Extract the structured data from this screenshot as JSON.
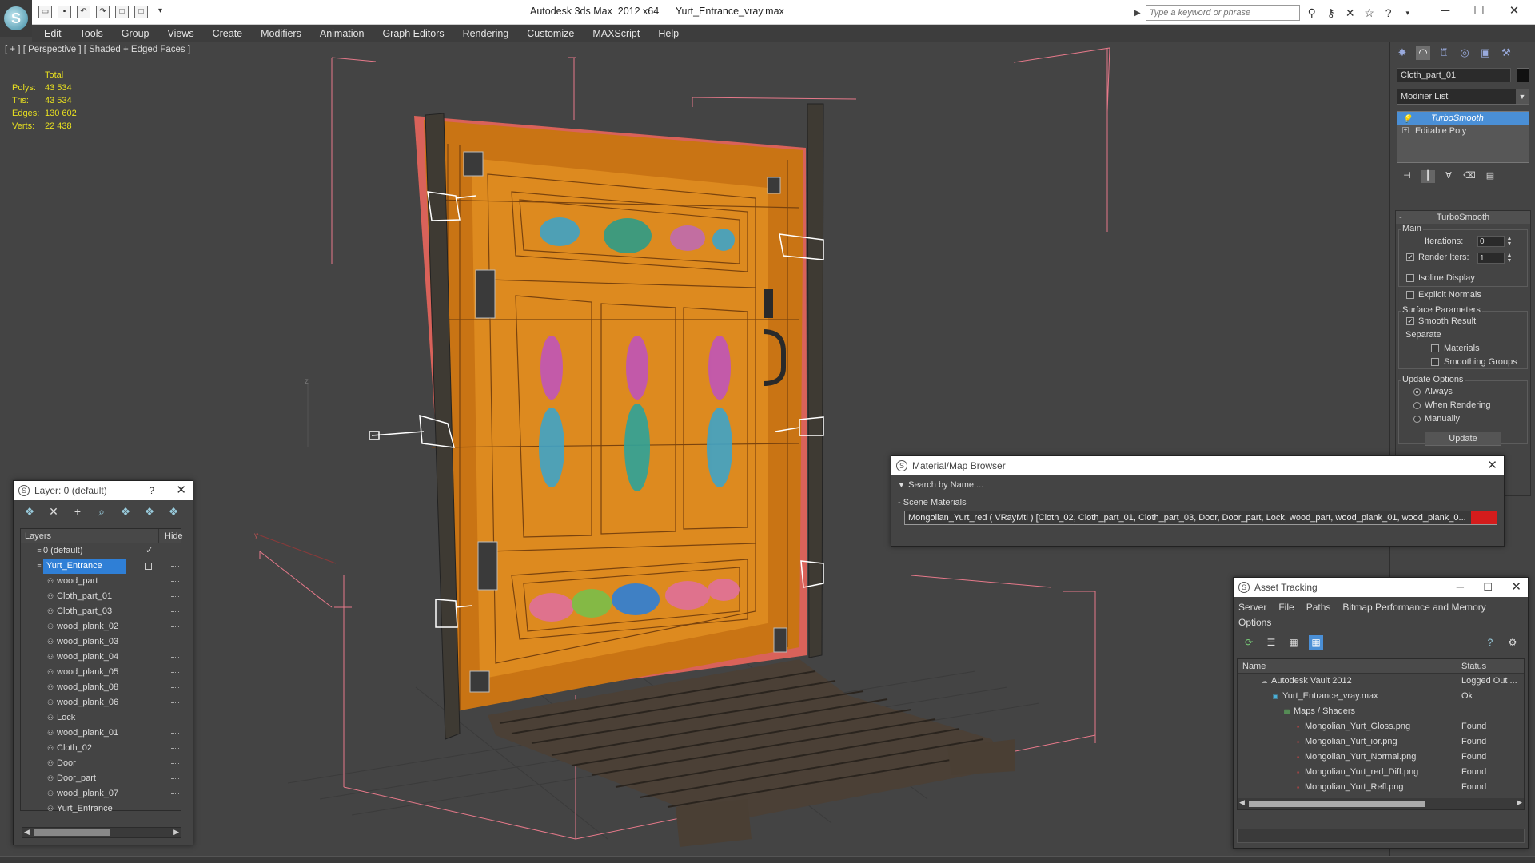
{
  "app": {
    "title": "Autodesk 3ds Max  2012 x64",
    "file": "Yurt_Entrance_vray.max",
    "search_placeholder": "Type a keyword or phrase"
  },
  "menu": [
    "Edit",
    "Tools",
    "Group",
    "Views",
    "Create",
    "Modifiers",
    "Animation",
    "Graph Editors",
    "Rendering",
    "Customize",
    "MAXScript",
    "Help"
  ],
  "viewport": {
    "label": "[ + ] [ Perspective ] [ Shaded + Edged Faces ]",
    "stats": {
      "total_label": "Total",
      "rows": [
        {
          "k": "Polys:",
          "v": "43 534"
        },
        {
          "k": "Tris:",
          "v": "43 534"
        },
        {
          "k": "Edges:",
          "v": "130 602"
        },
        {
          "k": "Verts:",
          "v": "22 438"
        }
      ]
    },
    "axis_z": "z",
    "axis_y": "y"
  },
  "command_panel": {
    "object_name": "Cloth_part_01",
    "modifier_list": "Modifier List",
    "stack": [
      "TurboSmooth",
      "Editable Poly"
    ],
    "turbosmooth": {
      "title": "TurboSmooth",
      "main": "Main",
      "iterations_label": "Iterations:",
      "iterations": "0",
      "render_iters_label": "Render Iters:",
      "render_iters": "1",
      "isoline": "Isoline Display",
      "explicit_normals": "Explicit Normals",
      "surface_params": "Surface Parameters",
      "smooth_result": "Smooth Result",
      "separate": "Separate",
      "materials": "Materials",
      "smoothing_groups": "Smoothing Groups",
      "update_options": "Update Options",
      "always": "Always",
      "when_rendering": "When Rendering",
      "manually": "Manually",
      "update_btn": "Update"
    }
  },
  "layer_dialog": {
    "title": "Layer: 0 (default)",
    "help": "?",
    "col_layers": "Layers",
    "col_hide": "Hide",
    "rows": [
      {
        "name": "0 (default)",
        "level": 0
      },
      {
        "name": "Yurt_Entrance",
        "level": 0,
        "selected": true
      },
      {
        "name": "wood_part",
        "level": 1
      },
      {
        "name": "Cloth_part_01",
        "level": 1
      },
      {
        "name": "Cloth_part_03",
        "level": 1
      },
      {
        "name": "wood_plank_02",
        "level": 1
      },
      {
        "name": "wood_plank_03",
        "level": 1
      },
      {
        "name": "wood_plank_04",
        "level": 1
      },
      {
        "name": "wood_plank_05",
        "level": 1
      },
      {
        "name": "wood_plank_08",
        "level": 1
      },
      {
        "name": "wood_plank_06",
        "level": 1
      },
      {
        "name": "Lock",
        "level": 1
      },
      {
        "name": "wood_plank_01",
        "level": 1
      },
      {
        "name": "Cloth_02",
        "level": 1
      },
      {
        "name": "Door",
        "level": 1
      },
      {
        "name": "Door_part",
        "level": 1
      },
      {
        "name": "wood_plank_07",
        "level": 1
      },
      {
        "name": "Yurt_Entrance",
        "level": 1
      }
    ]
  },
  "material_browser": {
    "title": "Material/Map Browser",
    "search": "Search by Name ...",
    "section": "Scene Materials",
    "item": "Mongolian_Yurt_red  ( VRayMtl ) [Cloth_02, Cloth_part_01, Cloth_part_03, Door, Door_part, Lock, wood_part, wood_plank_01, wood_plank_0..."
  },
  "asset_tracking": {
    "title": "Asset Tracking",
    "menu": [
      "Server",
      "File",
      "Paths",
      "Bitmap Performance and Memory",
      "Options"
    ],
    "col_name": "Name",
    "col_status": "Status",
    "rows": [
      {
        "name": "Autodesk Vault 2012",
        "status": "Logged Out ...",
        "indent": 1
      },
      {
        "name": "Yurt_Entrance_vray.max",
        "status": "Ok",
        "indent": 2
      },
      {
        "name": "Maps / Shaders",
        "status": "",
        "indent": 3
      },
      {
        "name": "Mongolian_Yurt_Gloss.png",
        "status": "Found",
        "indent": 4
      },
      {
        "name": "Mongolian_Yurt_ior.png",
        "status": "Found",
        "indent": 4
      },
      {
        "name": "Mongolian_Yurt_Normal.png",
        "status": "Found",
        "indent": 4
      },
      {
        "name": "Mongolian_Yurt_red_Diff.png",
        "status": "Found",
        "indent": 4
      },
      {
        "name": "Mongolian_Yurt_Refl.png",
        "status": "Found",
        "indent": 4
      }
    ]
  },
  "colors": {
    "ui_dark": "#444444",
    "selection_blue": "#2f7fd6",
    "stats_yellow": "#e8e020",
    "bbox_pink": "#e6798a",
    "door_orange": "#d9861c"
  }
}
